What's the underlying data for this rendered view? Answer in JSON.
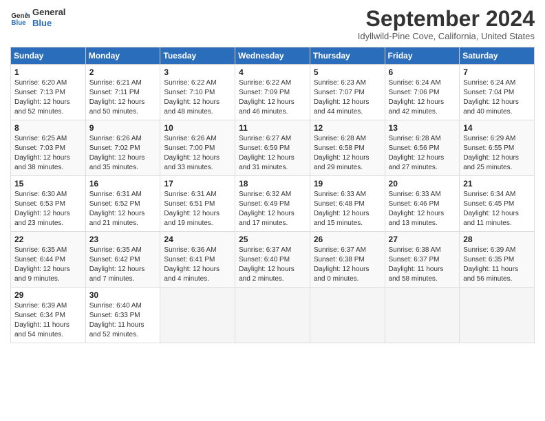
{
  "header": {
    "logo_line1": "General",
    "logo_line2": "Blue",
    "month": "September 2024",
    "location": "Idyllwild-Pine Cove, California, United States"
  },
  "days_of_week": [
    "Sunday",
    "Monday",
    "Tuesday",
    "Wednesday",
    "Thursday",
    "Friday",
    "Saturday"
  ],
  "weeks": [
    [
      {
        "day": "1",
        "info": "Sunrise: 6:20 AM\nSunset: 7:13 PM\nDaylight: 12 hours\nand 52 minutes."
      },
      {
        "day": "2",
        "info": "Sunrise: 6:21 AM\nSunset: 7:11 PM\nDaylight: 12 hours\nand 50 minutes."
      },
      {
        "day": "3",
        "info": "Sunrise: 6:22 AM\nSunset: 7:10 PM\nDaylight: 12 hours\nand 48 minutes."
      },
      {
        "day": "4",
        "info": "Sunrise: 6:22 AM\nSunset: 7:09 PM\nDaylight: 12 hours\nand 46 minutes."
      },
      {
        "day": "5",
        "info": "Sunrise: 6:23 AM\nSunset: 7:07 PM\nDaylight: 12 hours\nand 44 minutes."
      },
      {
        "day": "6",
        "info": "Sunrise: 6:24 AM\nSunset: 7:06 PM\nDaylight: 12 hours\nand 42 minutes."
      },
      {
        "day": "7",
        "info": "Sunrise: 6:24 AM\nSunset: 7:04 PM\nDaylight: 12 hours\nand 40 minutes."
      }
    ],
    [
      {
        "day": "8",
        "info": "Sunrise: 6:25 AM\nSunset: 7:03 PM\nDaylight: 12 hours\nand 38 minutes."
      },
      {
        "day": "9",
        "info": "Sunrise: 6:26 AM\nSunset: 7:02 PM\nDaylight: 12 hours\nand 35 minutes."
      },
      {
        "day": "10",
        "info": "Sunrise: 6:26 AM\nSunset: 7:00 PM\nDaylight: 12 hours\nand 33 minutes."
      },
      {
        "day": "11",
        "info": "Sunrise: 6:27 AM\nSunset: 6:59 PM\nDaylight: 12 hours\nand 31 minutes."
      },
      {
        "day": "12",
        "info": "Sunrise: 6:28 AM\nSunset: 6:58 PM\nDaylight: 12 hours\nand 29 minutes."
      },
      {
        "day": "13",
        "info": "Sunrise: 6:28 AM\nSunset: 6:56 PM\nDaylight: 12 hours\nand 27 minutes."
      },
      {
        "day": "14",
        "info": "Sunrise: 6:29 AM\nSunset: 6:55 PM\nDaylight: 12 hours\nand 25 minutes."
      }
    ],
    [
      {
        "day": "15",
        "info": "Sunrise: 6:30 AM\nSunset: 6:53 PM\nDaylight: 12 hours\nand 23 minutes."
      },
      {
        "day": "16",
        "info": "Sunrise: 6:31 AM\nSunset: 6:52 PM\nDaylight: 12 hours\nand 21 minutes."
      },
      {
        "day": "17",
        "info": "Sunrise: 6:31 AM\nSunset: 6:51 PM\nDaylight: 12 hours\nand 19 minutes."
      },
      {
        "day": "18",
        "info": "Sunrise: 6:32 AM\nSunset: 6:49 PM\nDaylight: 12 hours\nand 17 minutes."
      },
      {
        "day": "19",
        "info": "Sunrise: 6:33 AM\nSunset: 6:48 PM\nDaylight: 12 hours\nand 15 minutes."
      },
      {
        "day": "20",
        "info": "Sunrise: 6:33 AM\nSunset: 6:46 PM\nDaylight: 12 hours\nand 13 minutes."
      },
      {
        "day": "21",
        "info": "Sunrise: 6:34 AM\nSunset: 6:45 PM\nDaylight: 12 hours\nand 11 minutes."
      }
    ],
    [
      {
        "day": "22",
        "info": "Sunrise: 6:35 AM\nSunset: 6:44 PM\nDaylight: 12 hours\nand 9 minutes."
      },
      {
        "day": "23",
        "info": "Sunrise: 6:35 AM\nSunset: 6:42 PM\nDaylight: 12 hours\nand 7 minutes."
      },
      {
        "day": "24",
        "info": "Sunrise: 6:36 AM\nSunset: 6:41 PM\nDaylight: 12 hours\nand 4 minutes."
      },
      {
        "day": "25",
        "info": "Sunrise: 6:37 AM\nSunset: 6:40 PM\nDaylight: 12 hours\nand 2 minutes."
      },
      {
        "day": "26",
        "info": "Sunrise: 6:37 AM\nSunset: 6:38 PM\nDaylight: 12 hours\nand 0 minutes."
      },
      {
        "day": "27",
        "info": "Sunrise: 6:38 AM\nSunset: 6:37 PM\nDaylight: 11 hours\nand 58 minutes."
      },
      {
        "day": "28",
        "info": "Sunrise: 6:39 AM\nSunset: 6:35 PM\nDaylight: 11 hours\nand 56 minutes."
      }
    ],
    [
      {
        "day": "29",
        "info": "Sunrise: 6:39 AM\nSunset: 6:34 PM\nDaylight: 11 hours\nand 54 minutes."
      },
      {
        "day": "30",
        "info": "Sunrise: 6:40 AM\nSunset: 6:33 PM\nDaylight: 11 hours\nand 52 minutes."
      },
      {
        "day": "",
        "info": ""
      },
      {
        "day": "",
        "info": ""
      },
      {
        "day": "",
        "info": ""
      },
      {
        "day": "",
        "info": ""
      },
      {
        "day": "",
        "info": ""
      }
    ]
  ]
}
